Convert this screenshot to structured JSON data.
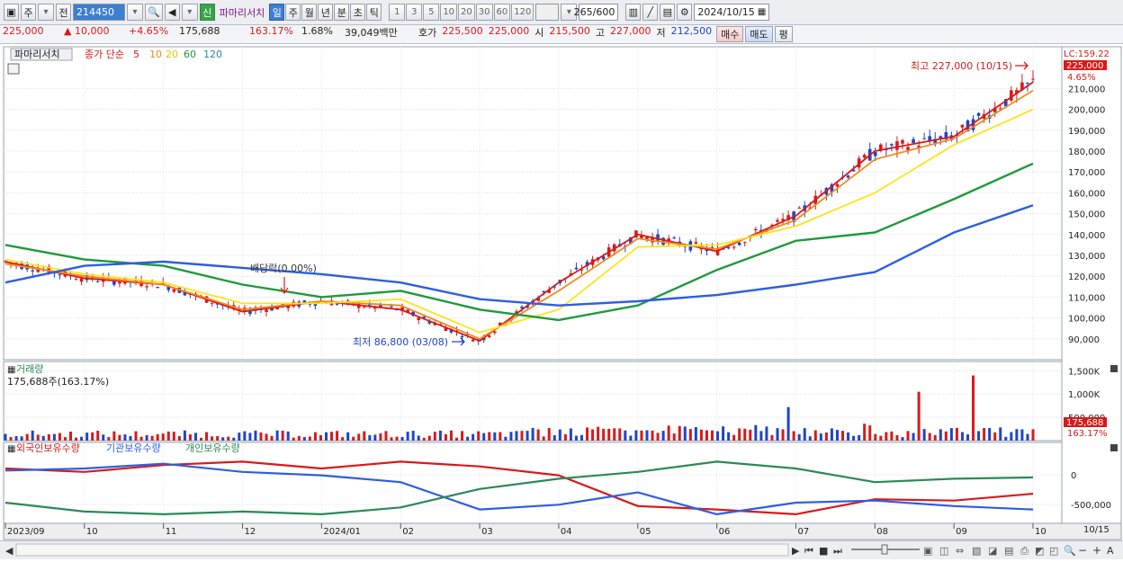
{
  "toolbar": {
    "market": "주",
    "prev_label": "전",
    "code": "214450",
    "new_badge": "신",
    "stock_name": "파마리서치",
    "periods": [
      "일",
      "주",
      "월",
      "년",
      "분",
      "초",
      "틱"
    ],
    "selected_period": "일",
    "intervals": [
      "1",
      "3",
      "5",
      "10",
      "20",
      "30",
      "60",
      "120"
    ],
    "count": "265",
    "max_count": "/600",
    "date": "2024/10/15"
  },
  "info": {
    "price": "225,000",
    "change": "▲ 10,000",
    "change_pct": "+4.65%",
    "volume": "175,688",
    "volume_ratio": "163.17%",
    "turnover": "1.68%",
    "amount": "39,049백만",
    "quote_label": "호가",
    "ask": "225,500",
    "bid": "225,000",
    "open_label": "시",
    "open": "215,500",
    "high_label": "고",
    "high": "227,000",
    "low_label": "저",
    "low": "212,500",
    "buy_label": "매수",
    "sell_label": "매도",
    "eval_label": "평"
  },
  "price_panel": {
    "title": "파마리서치",
    "ma_label": "종가 단순",
    "ma_periods": [
      "5",
      "10",
      "20",
      "60",
      "120"
    ],
    "lc_label": "LC:159.22",
    "current_tag": "225,000",
    "current_pct": "4.65%",
    "high_annotation": "최고 227,000 (10/15)",
    "low_annotation": "최저 86,800 (03/08)",
    "dividend_annotation": "배당락(0.00%)",
    "y_ticks": [
      "210,000",
      "200,000",
      "190,000",
      "180,000",
      "170,000",
      "160,000",
      "150,000",
      "140,000",
      "130,000",
      "120,000",
      "110,000",
      "100,000",
      "90,000"
    ]
  },
  "volume_panel": {
    "title": "거래량",
    "value_label": "175,688주(163.17%)",
    "y_ticks": [
      "1,500K",
      "1,000K",
      "500,000"
    ],
    "current_tag": "175,688",
    "current_pct": "163.17%"
  },
  "holdings_panel": {
    "legend": [
      "외국인보유수량",
      "기관보유수량",
      "개인보유수량"
    ],
    "y_ticks": [
      "0",
      "-500,000"
    ]
  },
  "x_axis": {
    "labels": [
      "2023/09",
      "10",
      "11",
      "12",
      "2024/01",
      "02",
      "03",
      "04",
      "05",
      "06",
      "07",
      "08",
      "09",
      "10"
    ],
    "right_label": "10/15"
  },
  "colors": {
    "up": "#d81a1a",
    "down": "#1f45c8",
    "ma5": "#d81a1a",
    "ma10": "#f08a1c",
    "ma20": "#ffe21a",
    "ma60": "#1e9a3c",
    "ma120": "#2e5ee0",
    "foreign": "#d81a1a",
    "institution": "#2e5ee0",
    "retail": "#2a8a55"
  },
  "chart_data": {
    "type": "line",
    "title": "파마리서치",
    "x": [
      "2023/09",
      "2023/10",
      "2023/11",
      "2023/12",
      "2024/01",
      "2024/02",
      "2024/03",
      "2024/04",
      "2024/05",
      "2024/06",
      "2024/07",
      "2024/08",
      "2024/09",
      "2024/10"
    ],
    "ylabel": "",
    "ylim": [
      80000,
      230000
    ],
    "series": [
      {
        "name": "5",
        "values": [
          127000,
          119000,
          116000,
          103000,
          108000,
          104000,
          89000,
          117000,
          140000,
          132000,
          149000,
          180000,
          187000,
          213000
        ]
      },
      {
        "name": "10",
        "values": [
          126000,
          120000,
          116000,
          104000,
          108000,
          106000,
          90000,
          113000,
          138000,
          133000,
          147000,
          176000,
          186000,
          209000
        ]
      },
      {
        "name": "20",
        "values": [
          128000,
          121000,
          117000,
          107000,
          107000,
          109000,
          93000,
          104000,
          134000,
          135000,
          144000,
          160000,
          183000,
          200000
        ]
      },
      {
        "name": "60",
        "values": [
          135000,
          128000,
          125000,
          116000,
          110000,
          113000,
          104000,
          99000,
          106000,
          123000,
          137000,
          141000,
          157000,
          174000
        ]
      },
      {
        "name": "120",
        "values": [
          117000,
          125000,
          127000,
          124000,
          121000,
          117000,
          109000,
          106000,
          108000,
          111000,
          116000,
          122000,
          141000,
          154000
        ]
      }
    ]
  }
}
